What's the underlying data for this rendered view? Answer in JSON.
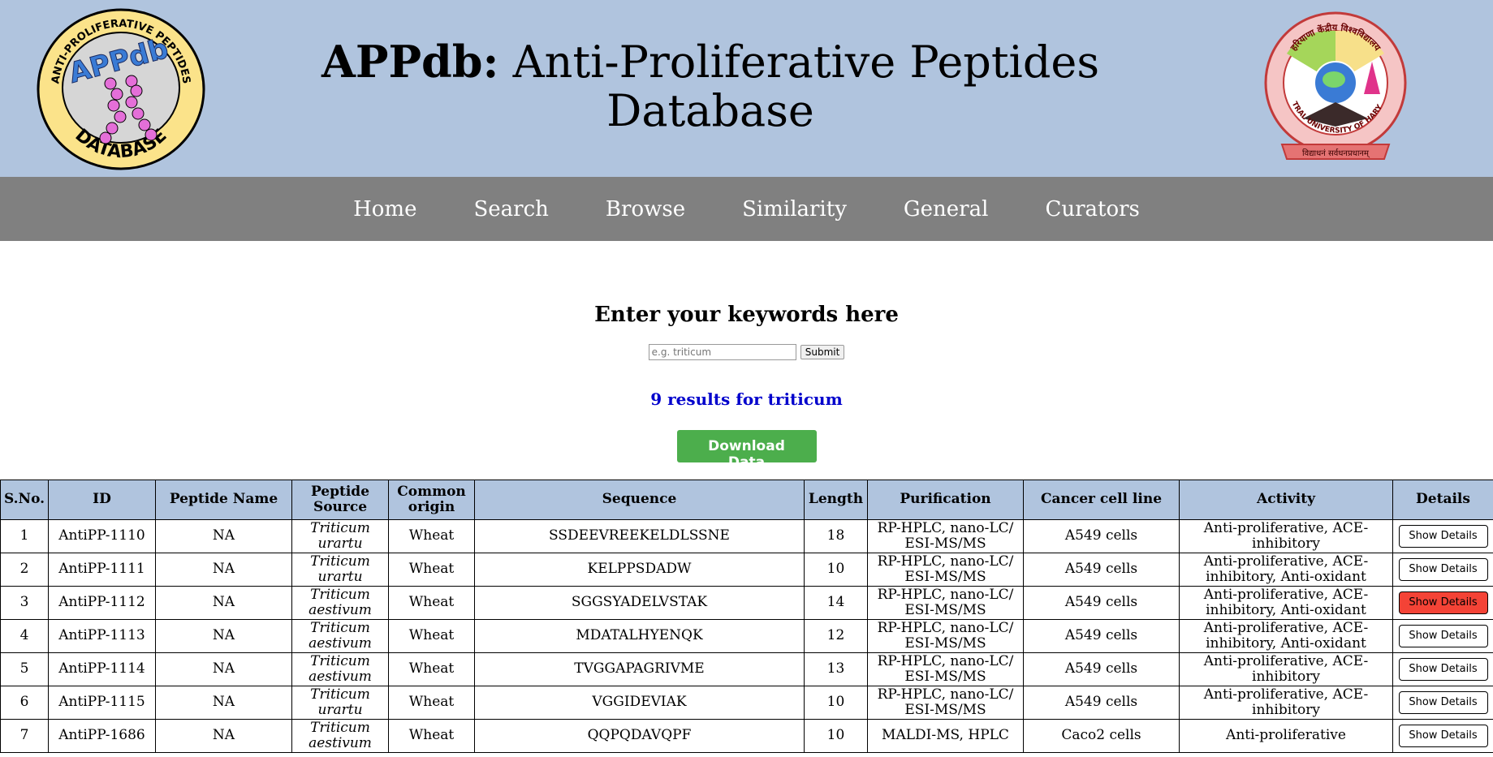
{
  "header": {
    "title_bold": "APPdb:",
    "title_rest": "Anti-Proliferative Peptides Database",
    "left_logo": {
      "ring_text": "ANTI-PROLIFERATIVE PEPTIDES",
      "inner": "APPdb",
      "bottom": "DATABASE"
    },
    "right_logo": {
      "top_text": "हरियाणा केंद्रीय विश्वविद्यालय",
      "ring_text": "CENTRAL UNIVERSITY OF HARYANA",
      "banner": "विद्याधनं सर्वधनप्रधानम्"
    }
  },
  "nav": [
    "Home",
    "Search",
    "Browse",
    "Similarity",
    "General",
    "Curators"
  ],
  "search": {
    "heading": "Enter your keywords here",
    "placeholder": "e.g. triticum",
    "submit_label": "Submit"
  },
  "results_text": "9 results for triticum",
  "download_label": "Download Data",
  "table": {
    "columns": [
      "S.No.",
      "ID",
      "Peptide Name",
      "Peptide Source",
      "Common origin",
      "Sequence",
      "Length",
      "Purification",
      "Cancer cell line",
      "Activity",
      "Details"
    ],
    "rows": [
      {
        "sno": "1",
        "id": "AntiPP-1110",
        "name": "NA",
        "source": "Triticum urartu",
        "origin": "Wheat",
        "sequence": "SSDEEVREEKELDLSSNE",
        "length": "18",
        "purification": "RP-HPLC, nano-LC/ ESI-MS/MS",
        "cell_line": "A549 cells",
        "activity": "Anti-proliferative, ACE-inhibitory",
        "details": "Show Details",
        "active": false
      },
      {
        "sno": "2",
        "id": "AntiPP-1111",
        "name": "NA",
        "source": "Triticum urartu",
        "origin": "Wheat",
        "sequence": "KELPPSDADW",
        "length": "10",
        "purification": "RP-HPLC, nano-LC/ ESI-MS/MS",
        "cell_line": "A549 cells",
        "activity": "Anti-proliferative, ACE-inhibitory, Anti-oxidant",
        "details": "Show Details",
        "active": false
      },
      {
        "sno": "3",
        "id": "AntiPP-1112",
        "name": "NA",
        "source": "Triticum aestivum",
        "origin": "Wheat",
        "sequence": "SGGSYADELVSTAK",
        "length": "14",
        "purification": "RP-HPLC, nano-LC/ ESI-MS/MS",
        "cell_line": "A549 cells",
        "activity": "Anti-proliferative, ACE-inhibitory, Anti-oxidant",
        "details": "Show Details",
        "active": true
      },
      {
        "sno": "4",
        "id": "AntiPP-1113",
        "name": "NA",
        "source": "Triticum aestivum",
        "origin": "Wheat",
        "sequence": "MDATALHYENQK",
        "length": "12",
        "purification": "RP-HPLC, nano-LC/ ESI-MS/MS",
        "cell_line": "A549 cells",
        "activity": "Anti-proliferative, ACE-inhibitory, Anti-oxidant",
        "details": "Show Details",
        "active": false
      },
      {
        "sno": "5",
        "id": "AntiPP-1114",
        "name": "NA",
        "source": "Triticum aestivum",
        "origin": "Wheat",
        "sequence": "TVGGAPAGRIVME",
        "length": "13",
        "purification": "RP-HPLC, nano-LC/ ESI-MS/MS",
        "cell_line": "A549 cells",
        "activity": "Anti-proliferative, ACE-inhibitory",
        "details": "Show Details",
        "active": false
      },
      {
        "sno": "6",
        "id": "AntiPP-1115",
        "name": "NA",
        "source": "Triticum urartu",
        "origin": "Wheat",
        "sequence": "VGGIDEVIAK",
        "length": "10",
        "purification": "RP-HPLC, nano-LC/ ESI-MS/MS",
        "cell_line": "A549 cells",
        "activity": "Anti-proliferative, ACE-inhibitory",
        "details": "Show Details",
        "active": false
      },
      {
        "sno": "7",
        "id": "AntiPP-1686",
        "name": "NA",
        "source": "Triticum aestivum",
        "origin": "Wheat",
        "sequence": "QQPQDAVQPF",
        "length": "10",
        "purification": "MALDI-MS, HPLC",
        "cell_line": "Caco2 cells",
        "activity": "Anti-proliferative",
        "details": "Show Details",
        "active": false
      }
    ]
  },
  "colors": {
    "header_bg": "#b0c4de",
    "nav_bg": "#808080",
    "results_text": "#0000cc",
    "download_bg": "#4cae4c",
    "active_details_bg": "#f44336"
  }
}
